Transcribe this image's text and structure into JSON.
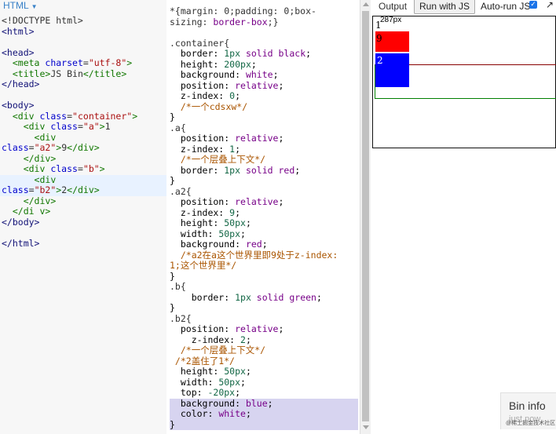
{
  "html_panel": {
    "tab_label": "HTML",
    "lines": [
      [
        {
          "t": "<!DOCTYPE html>",
          "c": "c-txt"
        }
      ],
      [
        {
          "t": "<html>",
          "c": "c-tag2"
        }
      ],
      [],
      [
        {
          "t": "<head>",
          "c": "c-tag2"
        }
      ],
      [
        {
          "t": "  "
        },
        {
          "t": "<meta ",
          "c": "c-tag"
        },
        {
          "t": "charset",
          "c": "c-attr"
        },
        {
          "t": "=",
          "c": "c-txt"
        },
        {
          "t": "\"utf-8\"",
          "c": "c-str"
        },
        {
          "t": ">",
          "c": "c-tag"
        }
      ],
      [
        {
          "t": "  "
        },
        {
          "t": "<title>",
          "c": "c-tag"
        },
        {
          "t": "JS Bin",
          "c": "c-txt"
        },
        {
          "t": "</title>",
          "c": "c-tag"
        }
      ],
      [
        {
          "t": "</head>",
          "c": "c-tag2"
        }
      ],
      [],
      [
        {
          "t": "<body>",
          "c": "c-tag2"
        }
      ],
      [
        {
          "t": "  "
        },
        {
          "t": "<div ",
          "c": "c-tag"
        },
        {
          "t": "class",
          "c": "c-attr"
        },
        {
          "t": "=",
          "c": "c-txt"
        },
        {
          "t": "\"container\"",
          "c": "c-str"
        },
        {
          "t": ">",
          "c": "c-tag"
        }
      ],
      [
        {
          "t": "    "
        },
        {
          "t": "<div ",
          "c": "c-tag"
        },
        {
          "t": "class",
          "c": "c-attr"
        },
        {
          "t": "=",
          "c": "c-txt"
        },
        {
          "t": "\"a\"",
          "c": "c-str"
        },
        {
          "t": ">",
          "c": "c-tag"
        },
        {
          "t": "1",
          "c": "c-txt"
        }
      ],
      [
        {
          "t": "      "
        },
        {
          "t": "<div",
          "c": "c-tag"
        }
      ],
      [
        {
          "t": "class",
          "c": "c-attr"
        },
        {
          "t": "=",
          "c": "c-txt"
        },
        {
          "t": "\"a2\"",
          "c": "c-str"
        },
        {
          "t": ">",
          "c": "c-tag"
        },
        {
          "t": "9",
          "c": "c-txt"
        },
        {
          "t": "</div>",
          "c": "c-tag"
        }
      ],
      [
        {
          "t": "    "
        },
        {
          "t": "</div>",
          "c": "c-tag"
        }
      ],
      [
        {
          "t": "    "
        },
        {
          "t": "<div ",
          "c": "c-tag"
        },
        {
          "t": "class",
          "c": "c-attr"
        },
        {
          "t": "=",
          "c": "c-txt"
        },
        {
          "t": "\"b\"",
          "c": "c-str"
        },
        {
          "t": ">",
          "c": "c-tag"
        }
      ],
      [
        {
          "t": "      "
        },
        {
          "t": "<div",
          "c": "c-tag"
        }
      ],
      [
        {
          "t": "class",
          "c": "c-attr"
        },
        {
          "t": "=",
          "c": "c-txt"
        },
        {
          "t": "\"b2\"",
          "c": "c-str"
        },
        {
          "t": ">",
          "c": "c-tag"
        },
        {
          "t": "2",
          "c": "c-txt"
        },
        {
          "t": "</div>",
          "c": "c-tag"
        }
      ],
      [
        {
          "t": "    "
        },
        {
          "t": "</div>",
          "c": "c-tag"
        }
      ],
      [
        {
          "t": "  "
        },
        {
          "t": "</di v>",
          "c": "c-tag"
        }
      ],
      [
        {
          "t": "</body>",
          "c": "c-tag2"
        }
      ],
      [],
      [
        {
          "t": "</html>",
          "c": "c-tag2"
        }
      ]
    ],
    "highlight_lines": [
      15,
      16
    ]
  },
  "css_panel": {
    "lines": [
      [
        {
          "t": "*{margin: 0;padding: 0;box-",
          "c": "c-sel"
        }
      ],
      [
        {
          "t": "sizing: ",
          "c": "c-prop"
        },
        {
          "t": "border-box",
          "c": "c-kw"
        },
        {
          "t": ";}",
          "c": "c-txt"
        }
      ],
      [],
      [
        {
          "t": ".container{",
          "c": "c-sel"
        }
      ],
      [
        {
          "t": "  border: "
        },
        {
          "t": "1px",
          "c": "c-num"
        },
        {
          "t": " solid ",
          "c": "c-kw"
        },
        {
          "t": "black",
          "c": "c-kw"
        },
        {
          "t": ";"
        }
      ],
      [
        {
          "t": "  height: "
        },
        {
          "t": "200px",
          "c": "c-num"
        },
        {
          "t": ";"
        }
      ],
      [
        {
          "t": "  background: "
        },
        {
          "t": "white",
          "c": "c-kw"
        },
        {
          "t": ";"
        }
      ],
      [
        {
          "t": "  position: "
        },
        {
          "t": "relative",
          "c": "c-kw"
        },
        {
          "t": ";"
        }
      ],
      [
        {
          "t": "  z-index: "
        },
        {
          "t": "0",
          "c": "c-num"
        },
        {
          "t": ";"
        }
      ],
      [
        {
          "t": "  /*一个cdsxw*/",
          "c": "c-comment"
        }
      ],
      [
        {
          "t": "}"
        }
      ],
      [
        {
          "t": ".a{",
          "c": "c-sel"
        }
      ],
      [
        {
          "t": "  position: "
        },
        {
          "t": "relative",
          "c": "c-kw"
        },
        {
          "t": ";"
        }
      ],
      [
        {
          "t": "  z-index: "
        },
        {
          "t": "1",
          "c": "c-num"
        },
        {
          "t": ";"
        }
      ],
      [
        {
          "t": "  /*一个层叠上下文*/",
          "c": "c-comment"
        }
      ],
      [
        {
          "t": "  border: "
        },
        {
          "t": "1px",
          "c": "c-num"
        },
        {
          "t": " solid ",
          "c": "c-kw"
        },
        {
          "t": "red",
          "c": "c-kw"
        },
        {
          "t": ";"
        }
      ],
      [
        {
          "t": "}"
        }
      ],
      [
        {
          "t": ".a2{",
          "c": "c-sel"
        }
      ],
      [
        {
          "t": "  position: "
        },
        {
          "t": "relative",
          "c": "c-kw"
        },
        {
          "t": ";"
        }
      ],
      [
        {
          "t": "  z-index: "
        },
        {
          "t": "9",
          "c": "c-num"
        },
        {
          "t": ";"
        }
      ],
      [
        {
          "t": "  height: "
        },
        {
          "t": "50px",
          "c": "c-num"
        },
        {
          "t": ";"
        }
      ],
      [
        {
          "t": "  width: "
        },
        {
          "t": "50px",
          "c": "c-num"
        },
        {
          "t": ";"
        }
      ],
      [
        {
          "t": "  background: "
        },
        {
          "t": "red",
          "c": "c-kw"
        },
        {
          "t": ";"
        }
      ],
      [
        {
          "t": "  /*a2在a这个世界里即9处于z-index:",
          "c": "c-comment"
        }
      ],
      [
        {
          "t": "1;这个世界里*/",
          "c": "c-comment"
        }
      ],
      [
        {
          "t": "}"
        }
      ],
      [
        {
          "t": ".b{",
          "c": "c-sel"
        }
      ],
      [
        {
          "t": "    border: "
        },
        {
          "t": "1px",
          "c": "c-num"
        },
        {
          "t": " solid ",
          "c": "c-kw"
        },
        {
          "t": "green",
          "c": "c-kw"
        },
        {
          "t": ";"
        }
      ],
      [
        {
          "t": "}"
        }
      ],
      [
        {
          "t": ".b2{",
          "c": "c-sel"
        }
      ],
      [
        {
          "t": "  position: "
        },
        {
          "t": "relative",
          "c": "c-kw"
        },
        {
          "t": ";"
        }
      ],
      [
        {
          "t": "    z-index: "
        },
        {
          "t": "2",
          "c": "c-num"
        },
        {
          "t": ";"
        }
      ],
      [
        {
          "t": "  /*一个层叠上下文*/",
          "c": "c-comment"
        }
      ],
      [
        {
          "t": " /*2盖住了1*/",
          "c": "c-comment"
        }
      ],
      [
        {
          "t": "  height: "
        },
        {
          "t": "50px",
          "c": "c-num"
        },
        {
          "t": ";"
        }
      ],
      [
        {
          "t": "  width: "
        },
        {
          "t": "50px",
          "c": "c-num"
        },
        {
          "t": ";"
        }
      ],
      [
        {
          "t": "  top: "
        },
        {
          "t": "-20px",
          "c": "c-num"
        },
        {
          "t": ";"
        }
      ],
      [
        {
          "t": "  background: "
        },
        {
          "t": "blue",
          "c": "c-kw"
        },
        {
          "t": ";"
        }
      ],
      [
        {
          "t": "  color: "
        },
        {
          "t": "white",
          "c": "c-kw"
        },
        {
          "t": ";"
        }
      ],
      [
        {
          "t": "}"
        }
      ]
    ],
    "selected_lines": [
      37,
      38,
      39
    ]
  },
  "output_panel": {
    "output_label": "Output",
    "run_button_label": "Run with JS",
    "autorun_label": "Auto-run JS",
    "autorun_checked": true,
    "preview": {
      "text_a": "1",
      "text_a2": "9",
      "text_b2": "2",
      "size_tip": "287px"
    },
    "bin_info": {
      "title": "Bin info",
      "subtitle": "just now",
      "watermark": "@稀土掘金技术社区"
    }
  },
  "colors": {
    "tab_blue": "#3a82c8",
    "a2_background": "#ff0000",
    "b2_background": "#0000ff",
    "b_border": "#008000",
    "selection": "#d7d4f0"
  }
}
